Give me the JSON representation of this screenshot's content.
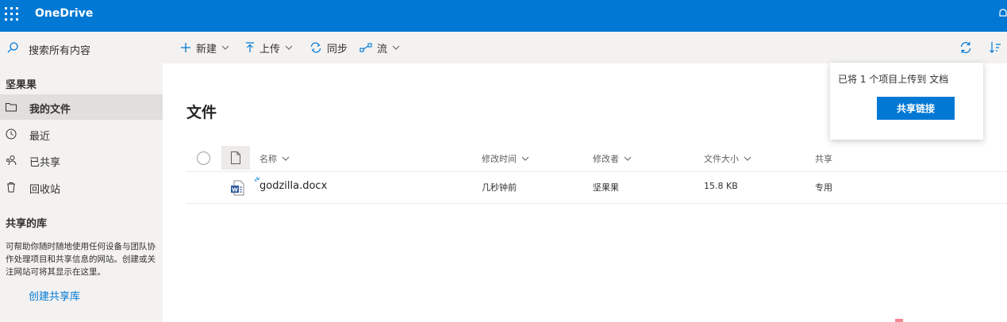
{
  "app": {
    "title": "OneDrive"
  },
  "sidebar": {
    "search_placeholder": "搜索所有内容",
    "user_section": "坚果果",
    "items": [
      {
        "label": "我的文件",
        "icon": "folder-icon",
        "active": true
      },
      {
        "label": "最近",
        "icon": "history-icon"
      },
      {
        "label": "已共享",
        "icon": "people-icon"
      },
      {
        "label": "回收站",
        "icon": "recycle-bin-icon"
      }
    ],
    "shared_libraries_title": "共享的库",
    "shared_libraries_desc": "可帮助你随时随地使用任何设备与团队协作处理项目和共享信息的网站。创建或关注网站可将其显示在这里。",
    "create_link": "创建共享库"
  },
  "commands": {
    "new": "新建",
    "upload": "上传",
    "sync": "同步",
    "flow": "流"
  },
  "main": {
    "title": "文件",
    "columns": {
      "name": "名称",
      "modified": "修改时间",
      "modified_by": "修改者",
      "size": "文件大小",
      "sharing": "共享"
    },
    "files": [
      {
        "name": "godzilla.docx",
        "modified": "几秒钟前",
        "modified_by": "坚果果",
        "size": "15.8 KB",
        "sharing": "专用",
        "icon": "word-doc-icon"
      }
    ]
  },
  "notification": {
    "message": "已将 1 个项目上传到 文档",
    "button": "共享链接"
  },
  "colors": {
    "brand": "#0078d4",
    "sidebar_bg": "#f3f2f1"
  }
}
